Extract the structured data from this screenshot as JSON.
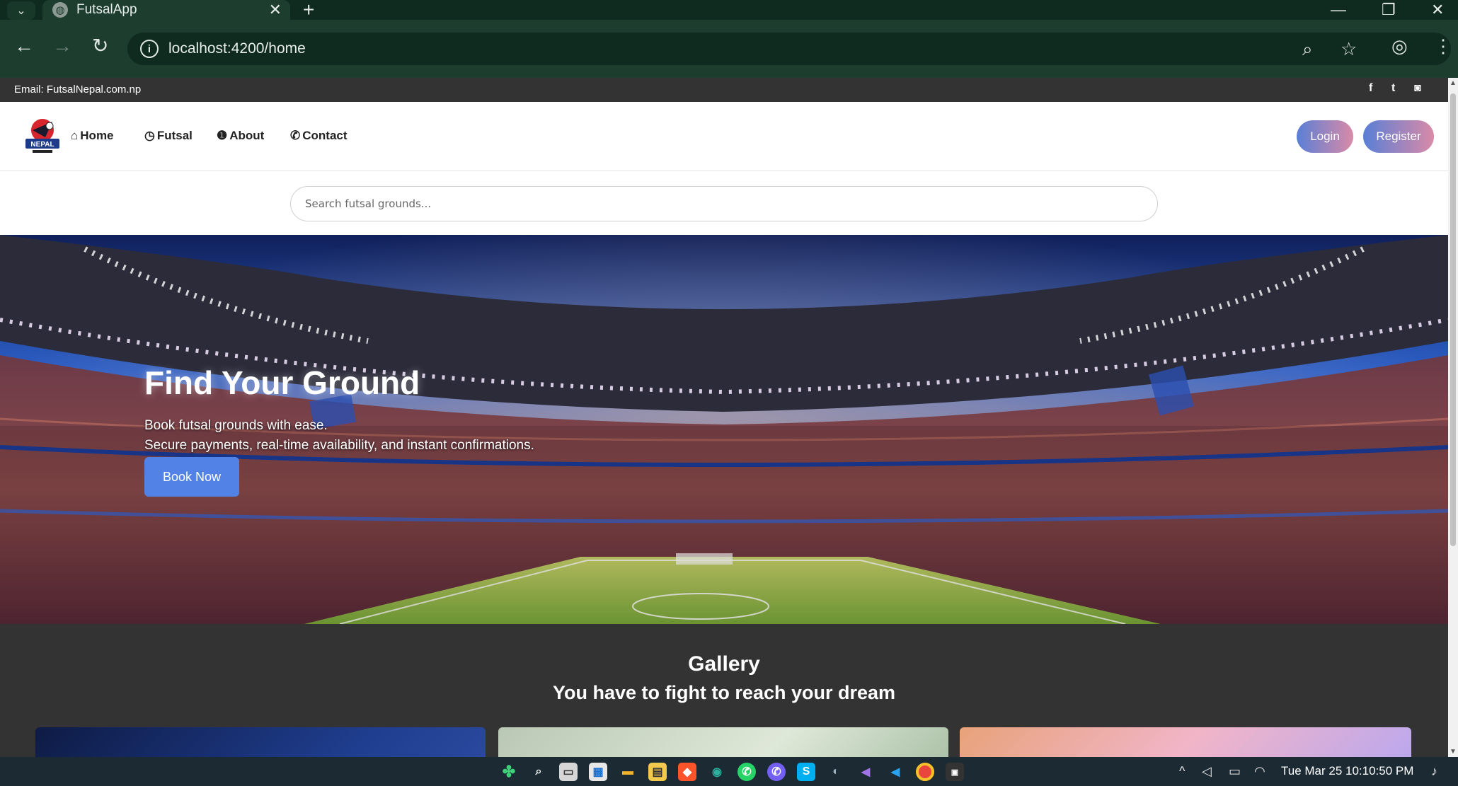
{
  "browser": {
    "tab_title": "FutsalApp",
    "tab_close": "✕",
    "new_tab": "+",
    "url": "localhost:4200/home",
    "window_controls": [
      "—",
      "❐",
      "✕"
    ]
  },
  "site": {
    "email_text": "Email: FutsalNepal.com.np",
    "social_icons": [
      "facebook-icon",
      "twitter-icon",
      "instagram-icon"
    ],
    "nav_items": [
      {
        "label": "Home",
        "icon": "home-icon"
      },
      {
        "label": "Futsal",
        "icon": "clock-icon"
      },
      {
        "label": "About",
        "icon": "info-icon"
      },
      {
        "label": "Contact",
        "icon": "phone-icon"
      }
    ],
    "login_label": "Login",
    "register_label": "Register",
    "search_placeholder": "Search futsal grounds..."
  },
  "hero": {
    "title": "Find Your Ground",
    "line1": "Book futsal grounds with ease.",
    "line2": "Secure payments, real-time availability, and instant confirmations.",
    "button_label": "Book Now"
  },
  "gallery": {
    "title": "Gallery",
    "subtitle": "You have to fight to reach your dream"
  },
  "taskbar": {
    "clock": "Tue Mar 25  10:10:50 PM"
  },
  "colors": {
    "topbar": "#333333",
    "brand_gradient_start": "#5a7fd6",
    "brand_gradient_end": "#d98aa7",
    "book_button": "#5282e6"
  }
}
